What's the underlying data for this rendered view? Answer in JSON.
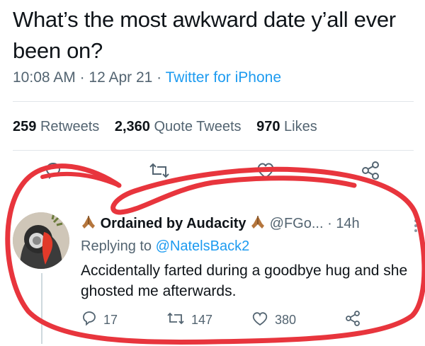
{
  "tweet": {
    "text": "What’s the most awkward date y’all ever been on?",
    "time": "10:08 AM",
    "date": "12 Apr 21",
    "source": "Twitter for iPhone"
  },
  "stats": {
    "retweets_count": "259",
    "retweets_label": "Retweets",
    "quotes_count": "2,360",
    "quotes_label": "Quote Tweets",
    "likes_count": "970",
    "likes_label": "Likes"
  },
  "icons": {
    "reply": "reply-icon",
    "retweet": "retweet-icon",
    "like": "heart-icon",
    "share": "share-icon",
    "more": "more-icon",
    "pray": "folded-hands-icon"
  },
  "reply": {
    "display_name": "Ordained by Audacity",
    "handle": "@FGo...",
    "time": "14h",
    "replying_prefix": "Replying to",
    "replying_to": "@NatelsBack2",
    "text": "Accidentally farted during a goodbye hug and she ghosted me afterwards.",
    "reply_count": "17",
    "retweet_count": "147",
    "like_count": "380"
  },
  "colors": {
    "accent": "#1d9bf0",
    "secondary_text": "#536471",
    "annotation_red": "#e8353d"
  }
}
